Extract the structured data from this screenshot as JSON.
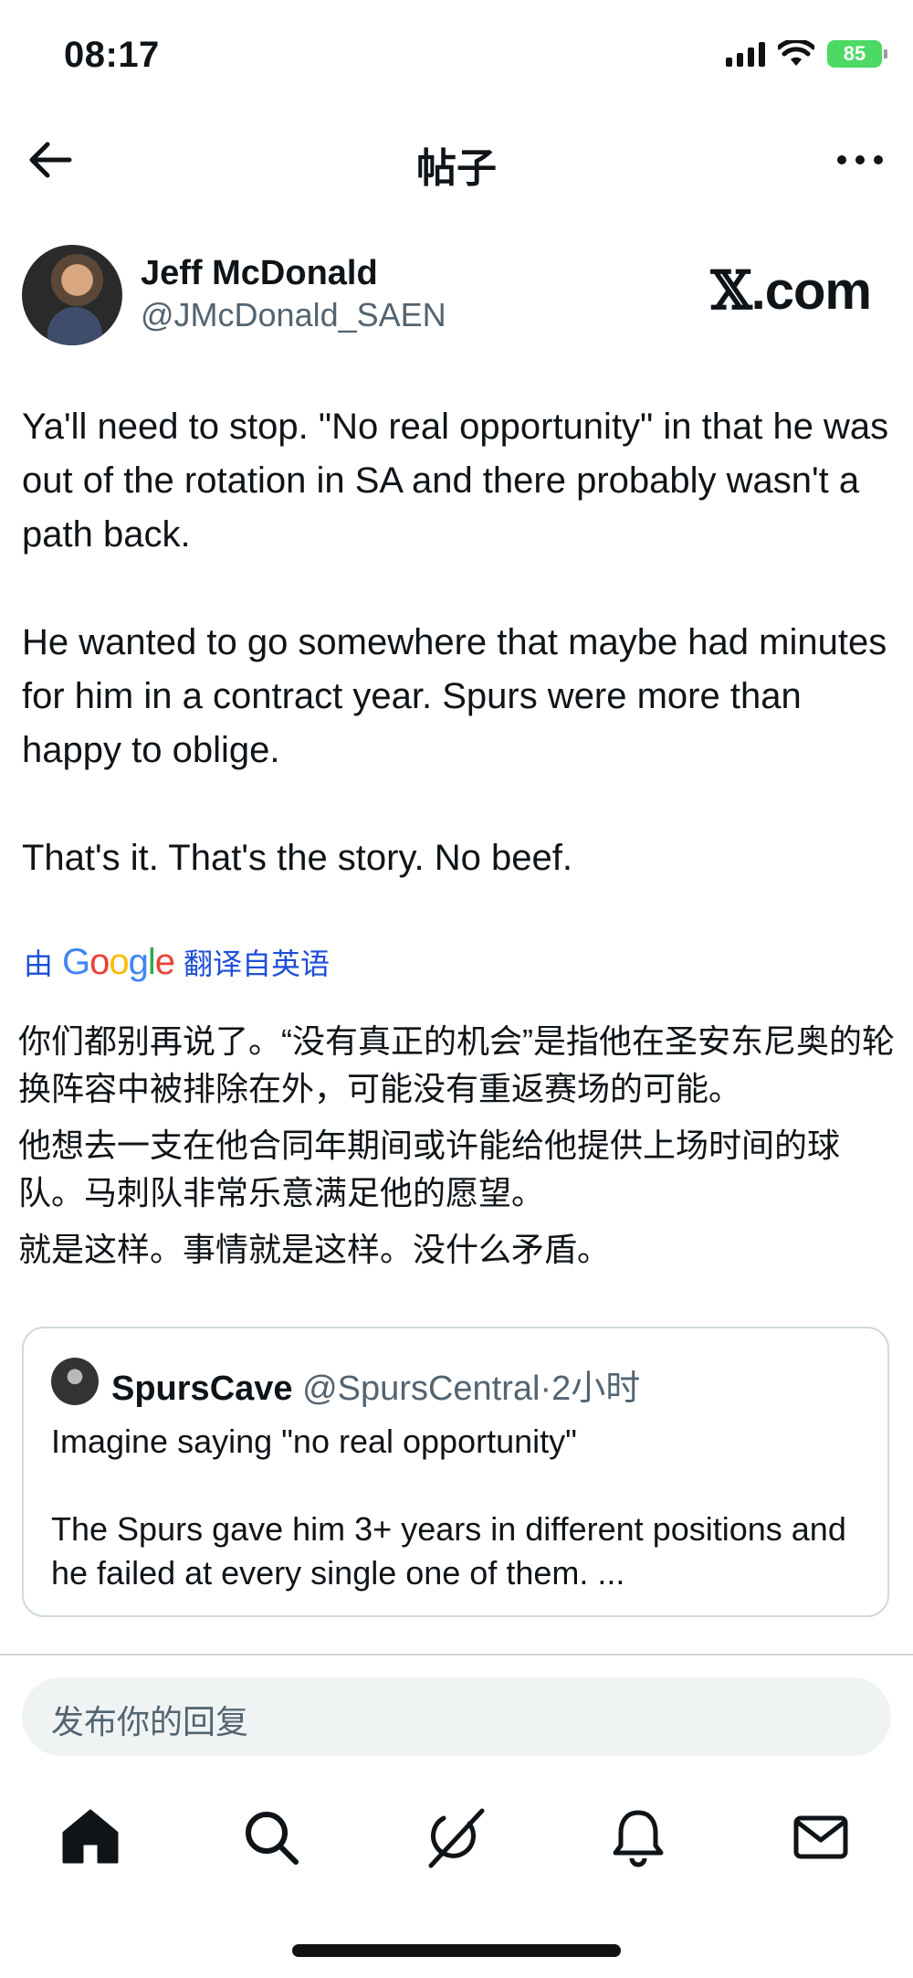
{
  "status_bar": {
    "time": "08:17",
    "battery": "85"
  },
  "header": {
    "title": "帖子"
  },
  "author": {
    "name": "Jeff McDonald",
    "handle": "@JMcDonald_SAEN"
  },
  "brand": {
    "x_glyph": "𝕏",
    "domain": ".com"
  },
  "tweet": {
    "paragraphs": [
      "Ya'll need to stop. \"No real opportunity\" in that he was out of the rotation in SA and there probably wasn't a path back.",
      "He wanted to go somewhere that maybe had minutes for him in a contract year. Spurs were more than happy to oblige.",
      "That's it. That's the story. No beef."
    ]
  },
  "translation": {
    "prefix": "由",
    "google_letters": [
      "G",
      "o",
      "o",
      "g",
      "l",
      "e"
    ],
    "suffix": "翻译自英语",
    "paragraphs": [
      "你们都别再说了。“没有真正的机会”是指他在圣安东尼奥的轮换阵容中被排除在外，可能没有重返赛场的可能。",
      "他想去一支在他合同年期间或许能给他提供上场时间的球队。马刺队非常乐意满足他的愿望。",
      "就是这样。事情就是这样。没什么矛盾。"
    ]
  },
  "quote": {
    "name": "SpursCave",
    "handle": "@SpursCentral",
    "separator": "·",
    "time": "2小时",
    "paragraphs": [
      "Imagine saying \"no real opportunity\"",
      "The Spurs gave him 3+ years in different positions and he failed at every single one of them. ..."
    ]
  },
  "reply": {
    "placeholder": "发布你的回复"
  },
  "nav": {
    "icons": [
      "home-icon",
      "search-icon",
      "grok-icon",
      "notifications-icon",
      "messages-icon"
    ]
  },
  "colors": {
    "text": "#0f1419",
    "secondary": "#536471",
    "border": "#cfd9de",
    "translate_link": "#1d4ed8",
    "battery": "#4cd964"
  }
}
